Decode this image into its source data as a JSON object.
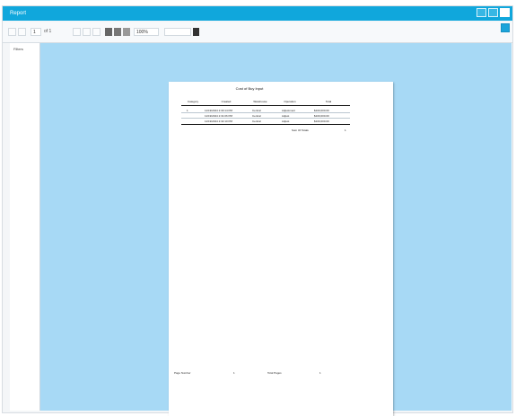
{
  "window": {
    "title": "Report",
    "colors": {
      "titlebar": "#10a7dc",
      "viewport": "#a7d9f5",
      "page": "#ffffff"
    }
  },
  "toolbar": {
    "page_input": "1",
    "page_of": "of 1",
    "zoom": "100%",
    "search": "",
    "print_icon": "printer-icon",
    "export_icon": "export-icon",
    "refresh_icon": "refresh-icon",
    "search_icon": "search-icon"
  },
  "left_panel": {
    "label": "Filters"
  },
  "report": {
    "title": "Cost of Buy Input",
    "columns": [
      "Category",
      "Created",
      "Warehouse",
      "Operation",
      "Total"
    ],
    "rows": [
      [
        "1",
        "11/19/2024 2:30:14 PM",
        "Central",
        "Adjustment",
        "$100,000.00"
      ],
      [
        "",
        "11/19/2024 2:31:06 PM",
        "Central",
        "Adjust",
        "$100,000.00"
      ],
      [
        "",
        "11/19/2024 2:32:10 PM",
        "Central",
        "Adjust",
        "$100,000.00"
      ]
    ],
    "total_label": "Sum Of Totals",
    "total_value": "1",
    "footer": {
      "left_label": "Page Number",
      "left_value": "1",
      "right_label": "Total Pages",
      "right_value": "1"
    }
  }
}
